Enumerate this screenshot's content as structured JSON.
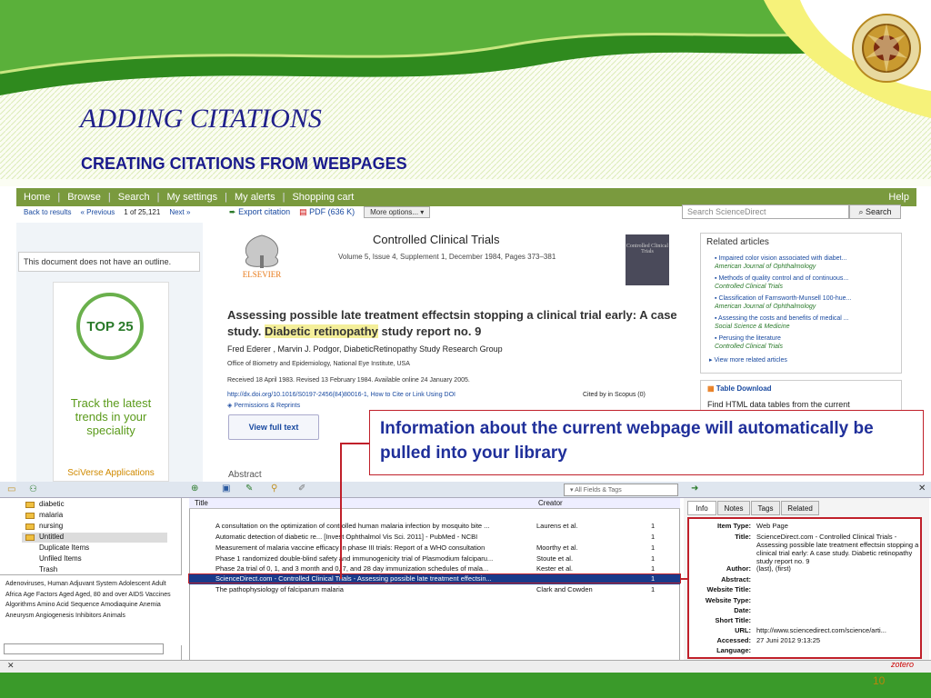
{
  "slide": {
    "title": "ADDING CITATIONS",
    "subtitle": "CREATING CITATIONS FROM WEBPAGES",
    "page_number": "10",
    "callout": "Information about the current webpage will automatically be pulled into your library"
  },
  "sciencedirect": {
    "nav": [
      "Home",
      "Browse",
      "Search",
      "My settings",
      "My alerts",
      "Shopping cart"
    ],
    "help": "Help",
    "back": "Back to results",
    "prev": "« Previous",
    "position": "1 of 25,121",
    "next": "Next »",
    "export": "Export citation",
    "pdf": "PDF (636 K)",
    "more_options": "More options...",
    "search_placeholder": "Search ScienceDirect",
    "search_button": "Search",
    "outline_msg": "This document does not have an outline.",
    "ad_badge": "TOP 25",
    "ad_text": "Track the latest trends in your speciality",
    "ad_footer": "SciVerse Applications",
    "journal": "Controlled Clinical Trials",
    "volume_line": "Volume 5, Issue 4, Supplement 1, December 1984, Pages 373–381",
    "publisher": "ELSEVIER",
    "cover_text": "Controlled Clinical Trials",
    "article_title_pre": "Assessing possible late treatment effectsin stopping a clinical trial early: A case study. ",
    "article_title_hl": "Diabetic retinopathy",
    "article_title_post": " study report no. 9",
    "authors": "Fred Ederer , Marvin J. Podgor, DiabeticRetinopathy Study Research Group",
    "affiliation": "Office of Biometry and Epidemiology, National Eye Institute, USA",
    "received": "Received 18 April 1983. Revised 13 February 1984. Available online 24 January 2005.",
    "doi": "http://dx.doi.org/10.1016/S0197-2456(84)80016-1, How to Cite or Link Using DOI",
    "cited": "Cited by in Scopus (0)",
    "permissions": "Permissions & Reprints",
    "view_full": "View full text",
    "abstract": "Abstract",
    "related_title": "Related articles",
    "related": [
      {
        "t": "Impaired color vision associated with diabet...",
        "j": "American Journal of Ophthalmology"
      },
      {
        "t": "Methods of quality control and of continuous...",
        "j": "Controlled Clinical Trials"
      },
      {
        "t": "Classification of Farnsworth-Munsell 100-hue...",
        "j": "American Journal of Ophthalmology"
      },
      {
        "t": "Assessing the costs and benefits of medical ...",
        "j": "Social Science & Medicine"
      },
      {
        "t": "Perusing the literature",
        "j": "Controlled Clinical Trials"
      }
    ],
    "related_more": "View more related articles",
    "table_download": "Table Download",
    "table_text": "Find HTML data tables from the current"
  },
  "zotero": {
    "collections": [
      "diabetic",
      "malaria",
      "nursing",
      "Untitled",
      "Duplicate Items",
      "Unfiled Items",
      "Trash"
    ],
    "tags": "Adenoviruses, Human   Adjuvant System   Adolescent   Adult   Africa   Age Factors   Aged   Aged, 80 and over   AIDS Vaccines   Algorithms   Amino Acid Sequence   Amodiaquine   Anemia   Aneurysm   Angiogenesis Inhibitors   Animals",
    "search_fields": "All Fields & Tags",
    "col_title": "Title",
    "col_creator": "Creator",
    "items": [
      {
        "t": "A consultation on the optimization of controlled human malaria infection by mosquito bite ...",
        "c": "Laurens et al.",
        "n": "1"
      },
      {
        "t": "Automatic detection of diabetic re... [Invest Ophthalmol Vis Sci. 2011] - PubMed - NCBI",
        "c": "",
        "n": "1"
      },
      {
        "t": "Measurement of malaria vaccine efficacy in phase III trials: Report of a WHO consultation",
        "c": "Moorthy et al.",
        "n": "1"
      },
      {
        "t": "Phase 1 randomized double-blind safety and immunogenicity trial of Plasmodium falciparu...",
        "c": "Stoute et al.",
        "n": "1"
      },
      {
        "t": "Phase 2a trial of 0, 1, and 3 month and 0, 7, and 28 day immunization schedules of mala...",
        "c": "Kester et al.",
        "n": "1"
      },
      {
        "t": "ScienceDirect.com - Controlled Clinical Trials - Assessing possible late treatment effectsin...",
        "c": "",
        "n": "1"
      },
      {
        "t": "The pathophysiology of falciparum malaria",
        "c": "Clark and Cowden",
        "n": "1"
      }
    ],
    "tabs": [
      "Info",
      "Notes",
      "Tags",
      "Related"
    ],
    "info": [
      {
        "l": "Item Type:",
        "v": "Web Page"
      },
      {
        "l": "Title:",
        "v": "ScienceDirect.com - Controlled Clinical Trials - Assessing possible late treatment effectsin stopping a clinical trial early: A case study. Diabetic retinopathy study report no. 9"
      },
      {
        "l": "Author:",
        "v": "(last), (first)"
      },
      {
        "l": "Abstract:",
        "v": ""
      },
      {
        "l": "Website Title:",
        "v": ""
      },
      {
        "l": "Website Type:",
        "v": ""
      },
      {
        "l": "Date:",
        "v": ""
      },
      {
        "l": "Short Title:",
        "v": ""
      },
      {
        "l": "URL:",
        "v": "http://www.sciencedirect.com/science/arti..."
      },
      {
        "l": "Accessed:",
        "v": "27 Juni 2012 9:13:25"
      },
      {
        "l": "Language:",
        "v": ""
      }
    ],
    "logo": "zotero"
  }
}
